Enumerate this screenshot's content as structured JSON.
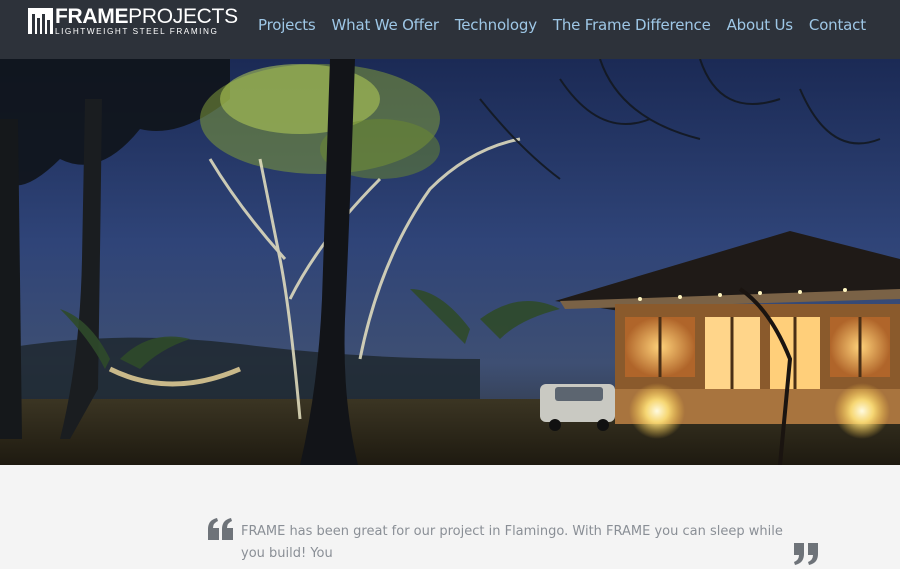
{
  "header": {
    "logo": {
      "word_bold": "FRAME",
      "word_light": "PROJECTS",
      "tagline": "LIGHTWEIGHT STEEL FRAMING"
    },
    "nav": [
      {
        "label": "Projects"
      },
      {
        "label": "What We Offer"
      },
      {
        "label": "Technology"
      },
      {
        "label": "The Frame Difference"
      },
      {
        "label": "About Us"
      },
      {
        "label": "Contact"
      }
    ]
  },
  "hero": {
    "icon": "night-house-photo"
  },
  "testimonial": {
    "quote": "FRAME has been great for our project in Flamingo. With FRAME you can sleep while you build! You"
  },
  "colors": {
    "nav_bg": "#2d323a",
    "nav_link": "#9ec7e6",
    "quote_text": "#8a8f96",
    "quote_mark": "#6e7379",
    "section_bg": "#f4f4f4"
  }
}
